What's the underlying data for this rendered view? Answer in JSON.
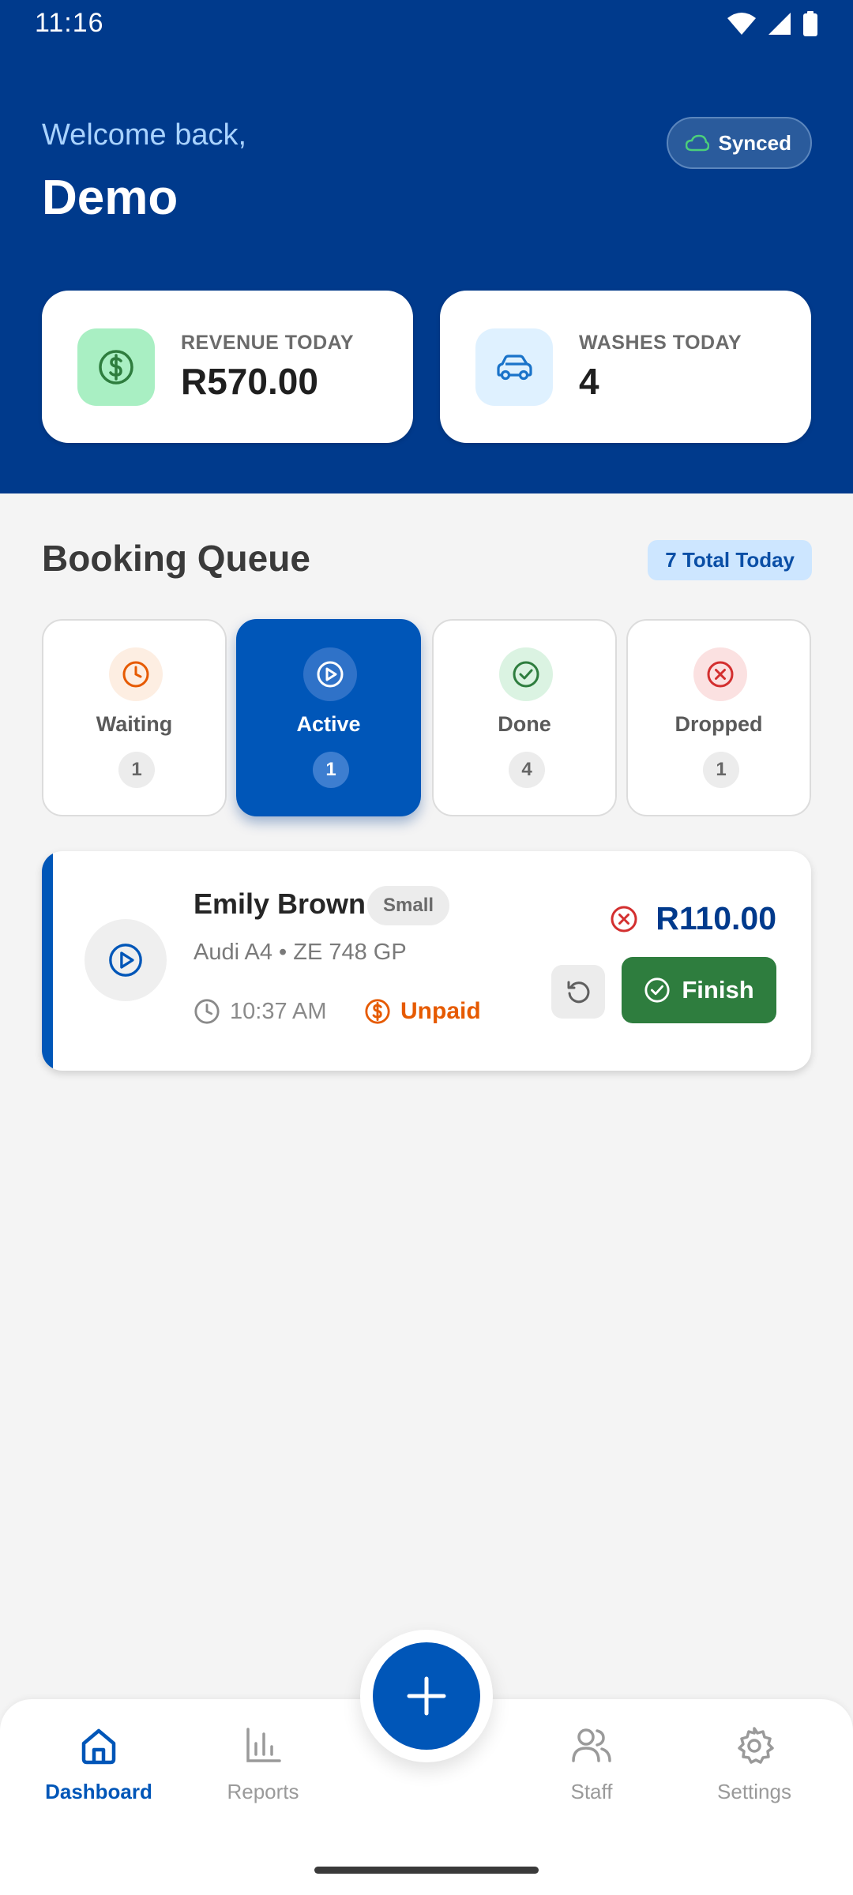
{
  "status_bar": {
    "time": "11:16"
  },
  "header": {
    "welcome": "Welcome back,",
    "user_name": "Demo",
    "sync_label": "Synced"
  },
  "stats": {
    "revenue": {
      "label": "REVENUE TODAY",
      "value": "R570.00"
    },
    "washes": {
      "label": "WASHES TODAY",
      "value": "4"
    }
  },
  "queue": {
    "title": "Booking Queue",
    "total_badge": "7 Total Today",
    "tabs": [
      {
        "label": "Waiting",
        "count": "1",
        "icon": "clock-icon",
        "color": "#e65a00"
      },
      {
        "label": "Active",
        "count": "1",
        "icon": "play-circle-icon",
        "color": "#ffffff"
      },
      {
        "label": "Done",
        "count": "4",
        "icon": "check-circle-icon",
        "color": "#2e7d3e"
      },
      {
        "label": "Dropped",
        "count": "1",
        "icon": "x-circle-icon",
        "color": "#d32f2f"
      }
    ],
    "selected_tab": "Active"
  },
  "booking": {
    "customer": "Emily Brown",
    "size": "Small",
    "vehicle": "Audi A4 • ZE 748 GP",
    "time": "10:37 AM",
    "payment_status": "Unpaid",
    "price": "R110.00",
    "finish_label": "Finish"
  },
  "nav": {
    "items": [
      {
        "label": "Dashboard",
        "icon": "home-icon"
      },
      {
        "label": "Reports",
        "icon": "bar-chart-icon"
      },
      {
        "label": "Staff",
        "icon": "users-icon"
      },
      {
        "label": "Settings",
        "icon": "gear-icon"
      }
    ],
    "selected": "Dashboard"
  },
  "colors": {
    "primary": "#0056b8",
    "header_bg": "#003a8c",
    "success": "#2e7d3e",
    "warning": "#e65a00",
    "danger": "#d32f2f"
  }
}
